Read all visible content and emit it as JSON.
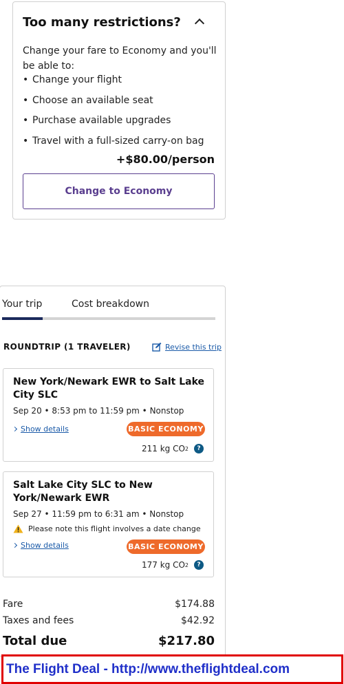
{
  "restrictions": {
    "title": "Too many restrictions?",
    "intro": "Change your fare to Economy and you'll be able to:",
    "benefits": [
      "Change your flight",
      "Choose an available seat",
      "Purchase available upgrades",
      "Travel with a full-sized carry-on bag"
    ],
    "price": "+$80.00/person",
    "button_label": "Change to Economy",
    "accent_color": "#5a3e8f"
  },
  "trip": {
    "tabs": [
      "Your trip",
      "Cost breakdown"
    ],
    "active_tab": "Your trip",
    "roundtrip_label": "ROUNDTRIP (1 TRAVELER)",
    "revise_label": "Revise this trip",
    "flights": [
      {
        "route": "New York/Newark EWR to Salt Lake City SLC",
        "time": "Sep 20 • 8:53 pm to 11:59 pm • Nonstop",
        "note": "",
        "details_label": "Show details",
        "fare_class": "BASIC ECONOMY",
        "co2_value": "211 kg CO",
        "co2_sub": "2"
      },
      {
        "route": "Salt Lake City SLC to New York/Newark EWR",
        "time": "Sep 27 • 11:59 pm to 6:31 am • Nonstop",
        "note": "Please note this flight involves a date change",
        "details_label": "Show details",
        "fare_class": "BASIC ECONOMY",
        "co2_value": "177 kg CO",
        "co2_sub": "2"
      }
    ],
    "summary": {
      "fare_label": "Fare",
      "fare_value": "$174.88",
      "taxes_label": "Taxes and fees",
      "taxes_value": "$42.92",
      "total_label": "Total due",
      "total_value": "$217.80"
    },
    "badge_color": "#ee6a2b",
    "link_color": "#1a5aa8"
  },
  "watermark": {
    "text": "The Flight Deal - http://www.theflightdeal.com"
  },
  "icons": [
    "chevron-up-icon",
    "edit-icon",
    "chevron-right-icon",
    "warning-icon",
    "help-icon"
  ]
}
